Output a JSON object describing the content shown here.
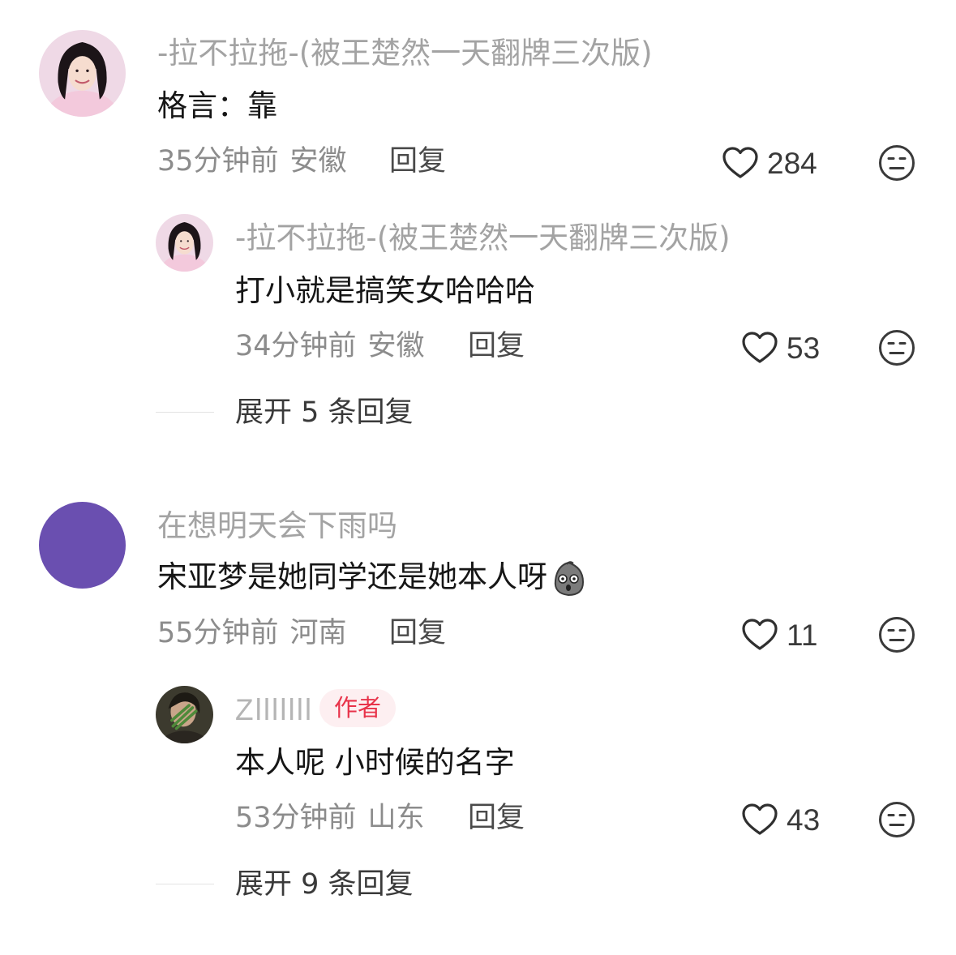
{
  "comments": [
    {
      "username": "-拉不拉拖-(被王楚然一天翻牌三次版)",
      "text": "格言：靠",
      "time": "35分钟前",
      "location": "安徽",
      "reply_label": "回复",
      "likes": "284",
      "replies": [
        {
          "username": "-拉不拉拖-(被王楚然一天翻牌三次版)",
          "text": "打小就是搞笑女哈哈哈",
          "time": "34分钟前",
          "location": "安徽",
          "reply_label": "回复",
          "likes": "53"
        }
      ],
      "expand_label": "展开 5 条回复"
    },
    {
      "username": "在想明天会下雨吗",
      "text": "宋亚梦是她同学还是她本人呀",
      "time": "55分钟前",
      "location": "河南",
      "reply_label": "回复",
      "likes": "11",
      "replies": [
        {
          "username": "Zlllllll",
          "badge": "作者",
          "text": "本人呢  小时候的名字",
          "time": "53分钟前",
          "location": "山东",
          "reply_label": "回复",
          "likes": "43"
        }
      ],
      "expand_label": "展开 9 条回复"
    }
  ],
  "colors": {
    "avatar_purple": "#6a4fb0",
    "badge_text": "#e8334a",
    "badge_bg": "#fdeff1"
  },
  "icons": {
    "like": "heart-outline-icon",
    "dislike": "meh-face-icon",
    "emoji": "shocked-blob-emoji"
  }
}
